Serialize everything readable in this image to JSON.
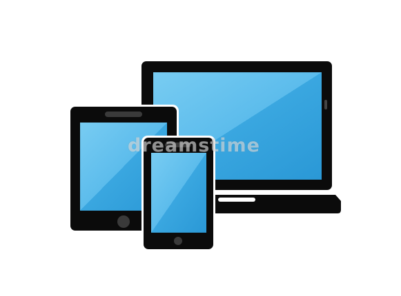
{
  "illustration": {
    "devices": [
      "laptop-icon",
      "tablet-icon",
      "smartphone-icon"
    ],
    "colors": {
      "background": "#ffffff",
      "device_body": "#0b0b0b",
      "screen_light": "#6ec6f0",
      "screen_dark": "#2f9fdb",
      "outline": "#ffffff"
    }
  },
  "watermark": {
    "text": "dreamstime"
  }
}
